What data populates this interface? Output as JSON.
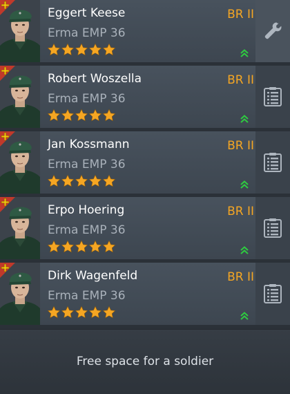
{
  "colors": {
    "name": "#ffffff",
    "weapon": "#a9b1ba",
    "br": "#f5a623",
    "star": "#f5a623",
    "upgrade": "#2ecc40",
    "rank_badge": "#c0392b"
  },
  "soldiers": [
    {
      "name": "Eggert Keese",
      "weapon": "Erma EMP 36",
      "br": "BR II",
      "stars": 5,
      "action_icon": "wrench-icon"
    },
    {
      "name": "Robert Woszella",
      "weapon": "Erma EMP 36",
      "br": "BR II",
      "stars": 5,
      "action_icon": "list-icon"
    },
    {
      "name": "Jan Kossmann",
      "weapon": "Erma EMP 36",
      "br": "BR II",
      "stars": 5,
      "action_icon": "list-icon"
    },
    {
      "name": "Erpo Hoering",
      "weapon": "Erma EMP 36",
      "br": "BR II",
      "stars": 5,
      "action_icon": "list-icon"
    },
    {
      "name": "Dirk Wagenfeld",
      "weapon": "Erma EMP 36",
      "br": "BR II",
      "stars": 5,
      "action_icon": "list-icon"
    }
  ],
  "free_slot": {
    "label": "Free space for a soldier"
  }
}
